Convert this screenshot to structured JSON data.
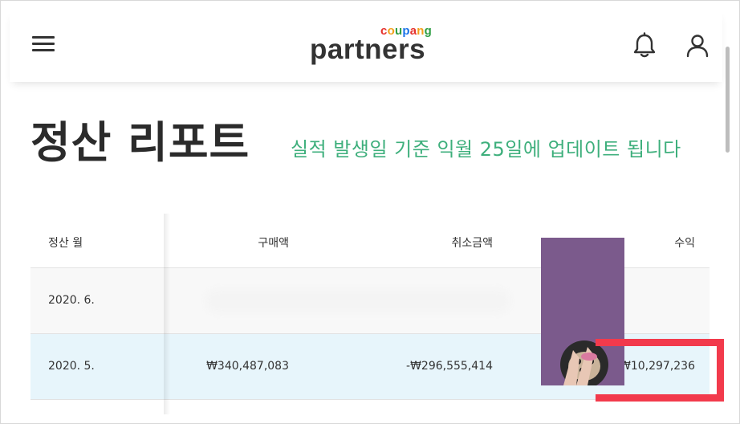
{
  "header": {
    "logo_top": "coupang",
    "logo_main": "partners",
    "logo_colors": [
      "#e5322d",
      "#f2a01b",
      "#2f9e44",
      "#1a73e8"
    ]
  },
  "page": {
    "title": "정산 리포트",
    "subtitle": "실적 발생일 기준 익월 25일에 업데이트 됩니다",
    "subtitle_color": "#3eaf7c"
  },
  "table": {
    "headers": {
      "month": "정산 월",
      "purchase": "구매액",
      "cancel": "취소금액",
      "income": "수익"
    },
    "rows": [
      {
        "month": "2020. 6.",
        "purchase": "",
        "cancel": "",
        "income": ""
      },
      {
        "month": "2020. 5.",
        "purchase": "₩340,487,083",
        "cancel": "-₩296,555,414",
        "income": "₩10,297,236"
      }
    ]
  },
  "annotation": {
    "highlight_color": "#f23a4c"
  },
  "icons": [
    "hamburger-menu-icon",
    "bell-icon",
    "user-icon"
  ]
}
